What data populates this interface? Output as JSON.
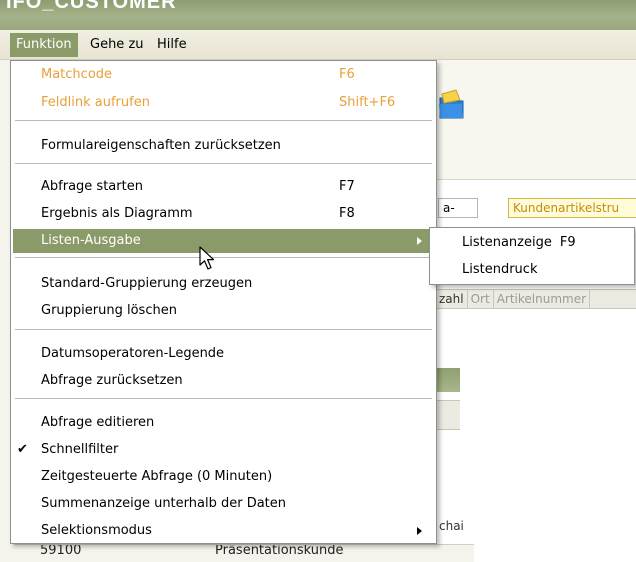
{
  "window": {
    "title_fragment": "IFO_CUSTOMER"
  },
  "menubar": {
    "items": [
      "Funktion",
      "Gehe zu",
      "Hilfe"
    ]
  },
  "menu": {
    "items": [
      {
        "label": "Matchcode",
        "shortcut": "F6"
      },
      {
        "label": "Feldlink aufrufen",
        "shortcut": "Shift+F6"
      },
      {
        "label": "Formulareigenschaften zurücksetzen"
      },
      {
        "label": "Abfrage starten",
        "shortcut": "F7"
      },
      {
        "label": "Ergebnis als Diagramm",
        "shortcut": "F8"
      },
      {
        "label": "Listen-Ausgabe",
        "has_submenu": true,
        "highlighted": true
      },
      {
        "label": "Standard-Gruppierung erzeugen"
      },
      {
        "label": "Gruppierung löschen"
      },
      {
        "label": "Datumsoperatoren-Legende"
      },
      {
        "label": "Abfrage zurücksetzen"
      },
      {
        "label": "Abfrage editieren"
      },
      {
        "label": "Schnellfilter",
        "checked": true
      },
      {
        "label": "Zeitgesteuerte Abfrage (0 Minuten)"
      },
      {
        "label": "Summenanzeige unterhalb der Daten"
      },
      {
        "label": "Selektionsmodus",
        "has_submenu": true
      }
    ],
    "check_glyph": "✔"
  },
  "submenu": {
    "items": [
      {
        "label": "Listenanzeige",
        "shortcut": "F9"
      },
      {
        "label": "Listendruck"
      }
    ]
  },
  "background": {
    "filter_cells": [
      "a-",
      "Kundenartikelstru"
    ],
    "column_headers": [
      "zahl",
      "Ort",
      "Artikelnummer"
    ],
    "row_fragment": "chai",
    "bottom_row": {
      "number": "59100",
      "text": "Präsentationskunde"
    }
  },
  "colors": {
    "title_bar": "#a6b38a",
    "highlight": "#8a9a69",
    "disabled_orange": "#e8a03a"
  }
}
